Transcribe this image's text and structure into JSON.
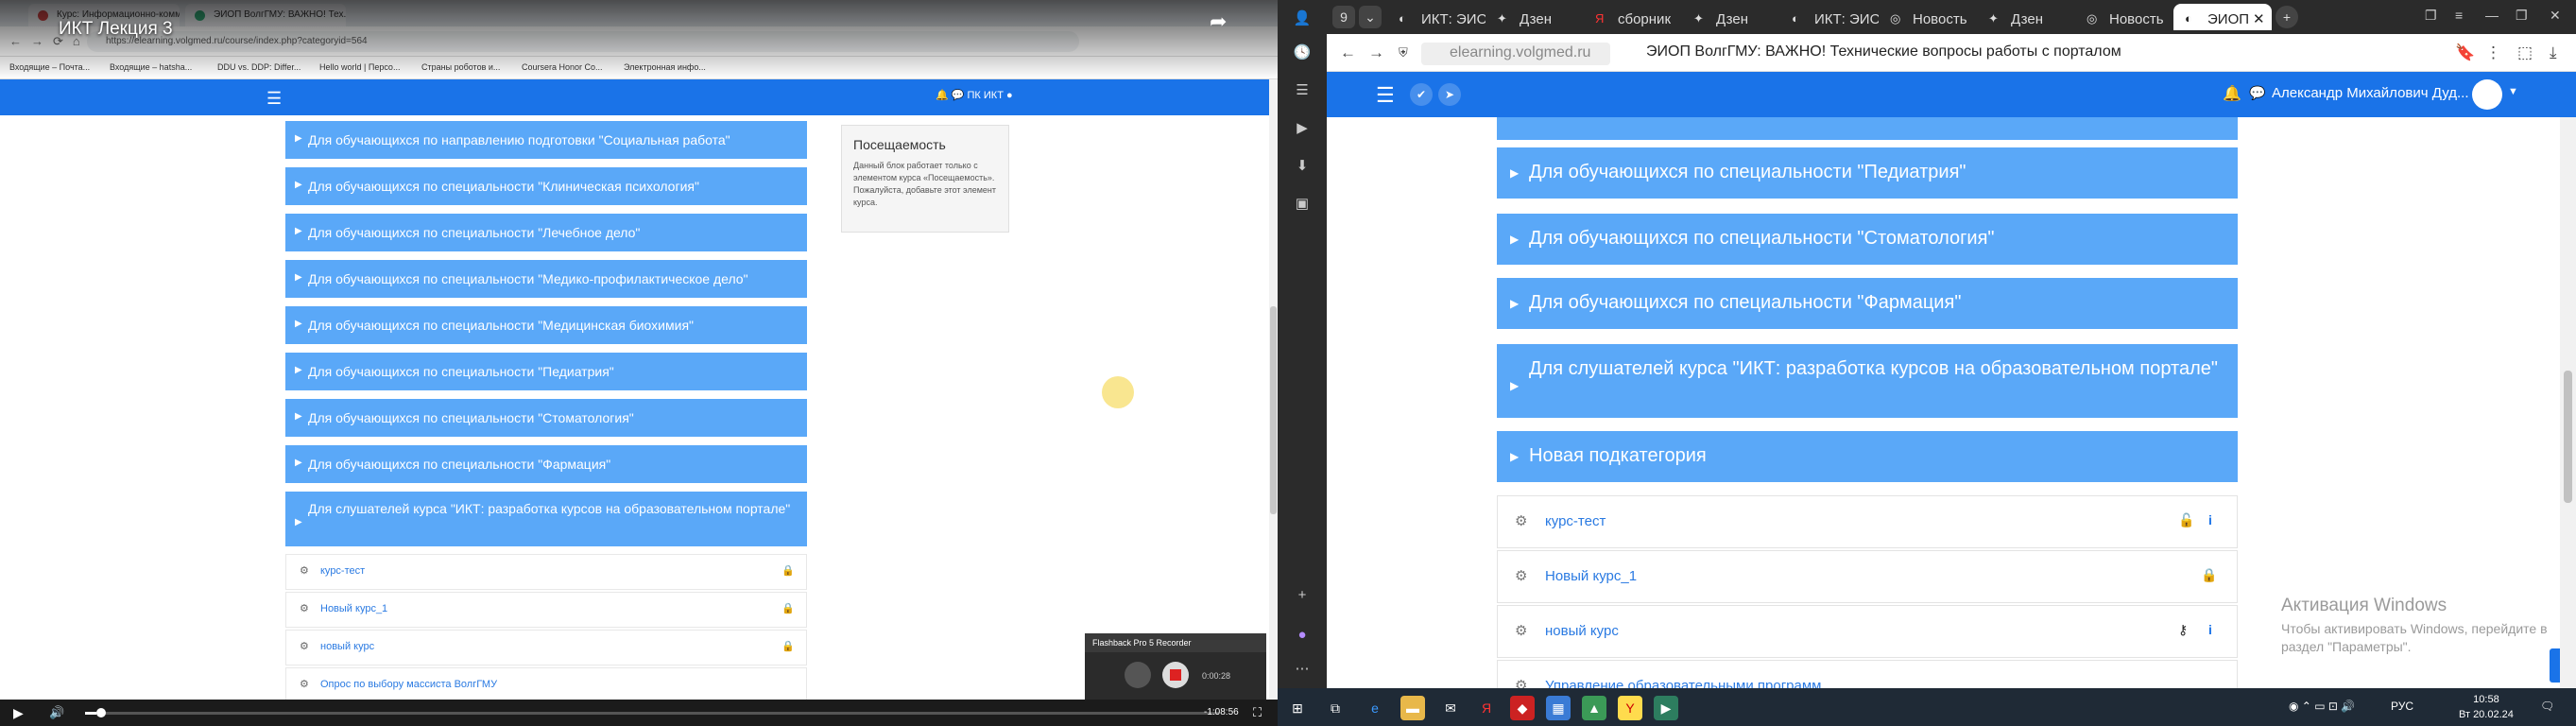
{
  "left": {
    "video_title": "ИКТ Лекция 3",
    "tabs": [
      "Курс: Информационно-комм...",
      "ЭИОП ВолгГМУ: ВАЖНО! Тех..."
    ],
    "url": "https://elearning.volgmed.ru/course/index.php?categoryid=564",
    "bookmarks": [
      "Входящие – Почта...",
      "Входящие – hatsha...",
      "DDU vs. DDP: Differ...",
      "Hello world | Персо...",
      "Страны роботов и...",
      "Coursera Honor Co...",
      "Электронная инфо..."
    ],
    "nav_user": "ПК ИКТ",
    "items": [
      "Для обучающихся по направлению подготовки \"Социальная работа\"",
      "Для обучающихся по специальности \"Клиническая психология\"",
      "Для обучающихся по специальности \"Лечебное дело\"",
      "Для обучающихся по специальности \"Медико-профилактическое дело\"",
      "Для обучающихся по специальности \"Медицинская биохимия\"",
      "Для обучающихся по специальности \"Педиатрия\"",
      "Для обучающихся по специальности \"Стоматология\"",
      "Для обучающихся по специальности \"Фармация\"",
      "Для слушателей курса \"ИКТ: разработка курсов на образовательном портале\""
    ],
    "courses": [
      "курс-тест",
      "Новый курс_1",
      "новый курс",
      "Опрос по выбору массиста ВолгГМУ"
    ],
    "block": {
      "title": "Посещаемость",
      "text": "Данный блок работает только с элементом курса «Посещаемость». Пожалуйста, добавьте этот элемент курса."
    },
    "recorder": {
      "title": "Flashback Pro 5 Recorder",
      "time": "0:00:28"
    },
    "player": {
      "time": "-1:08:56",
      "progress": 0.01
    }
  },
  "right": {
    "tab_count": "9",
    "tabs": [
      {
        "label": "ИКТ: ЭИО",
        "icon": "moodle-icon"
      },
      {
        "label": "Дзен",
        "icon": "dzen-icon"
      },
      {
        "label": "сборник",
        "icon": "yandex-icon"
      },
      {
        "label": "Дзен",
        "icon": "dzen-icon"
      },
      {
        "label": "ИКТ: ЭИО",
        "icon": "moodle-icon"
      },
      {
        "label": "Новость",
        "icon": "moodle-icon"
      },
      {
        "label": "Дзен",
        "icon": "dzen-icon"
      },
      {
        "label": "Новость",
        "icon": "moodle-icon"
      },
      {
        "label": "ЭИОП",
        "icon": "moodle-icon"
      }
    ],
    "domain": "elearning.volgmed.ru",
    "page_title": "ЭИОП ВолгГМУ: ВАЖНО! Технические вопросы работы с порталом",
    "user_name": "Александр Михайлович Дуд...",
    "items": [
      "Для обучающихся по специальности \"Педиатрия\"",
      "Для обучающихся по специальности \"Стоматология\"",
      "Для обучающихся по специальности \"Фармация\"",
      "Для слушателей курса \"ИКТ: разработка курсов на образовательном портале\"",
      "Новая подкатегория"
    ],
    "courses": [
      "курс-тест",
      "Новый курс_1",
      "новый курс",
      "Управление образовательными программ..."
    ],
    "activation": {
      "title": "Активация Windows",
      "text": "Чтобы активировать Windows, перейдите в раздел \"Параметры\"."
    },
    "taskbar": {
      "lang": "РУС",
      "time": "10:58",
      "date": "Вт 20.02.24"
    }
  },
  "colors": {
    "accent": "#1a73e8",
    "category": "#5aa8f8"
  }
}
